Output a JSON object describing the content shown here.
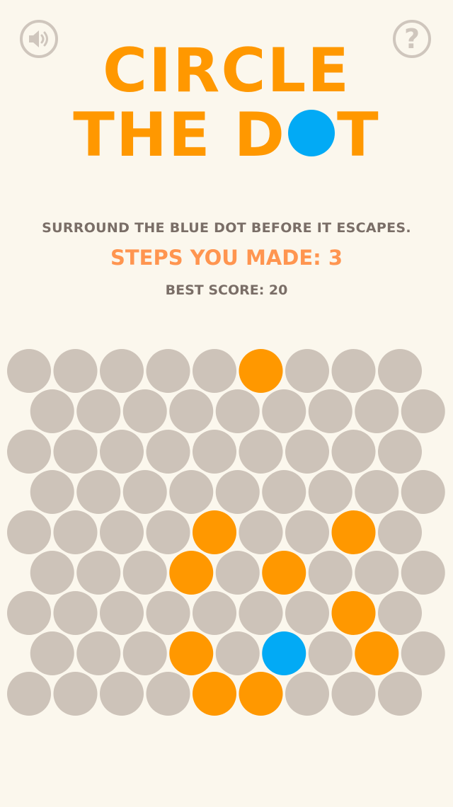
{
  "header": {
    "title_line1": "CIRCLE",
    "title_line2_a": "THE D",
    "title_line2_b": "T",
    "sound_icon": "speaker-icon",
    "help_icon": "question-mark-icon",
    "help_glyph": "?"
  },
  "info": {
    "instructions": "SURROUND THE BLUE DOT BEFORE IT ESCAPES.",
    "steps": "STEPS YOU MADE: 3",
    "best": "BEST SCORE: 20"
  },
  "colors": {
    "background": "#fbf7ed",
    "empty_cell": "#cdc3b9",
    "blocked_cell": "#ff9800",
    "dot": "#02aaf5",
    "title": "#ff9800",
    "steps_text": "#ff9550",
    "gray_text": "#7a6e67"
  },
  "board": {
    "rows": 9,
    "cols": 9,
    "cells": [
      "EEEEEBEEE",
      "EEEEEEEEE",
      "EEEEEEEEE",
      "EEEEEEEEE",
      "EEEEBEEBE",
      "EEEBEBEEE",
      "EEEEEEEBE",
      "EEEBEDEBE",
      "EEEEBBEEE"
    ]
  }
}
